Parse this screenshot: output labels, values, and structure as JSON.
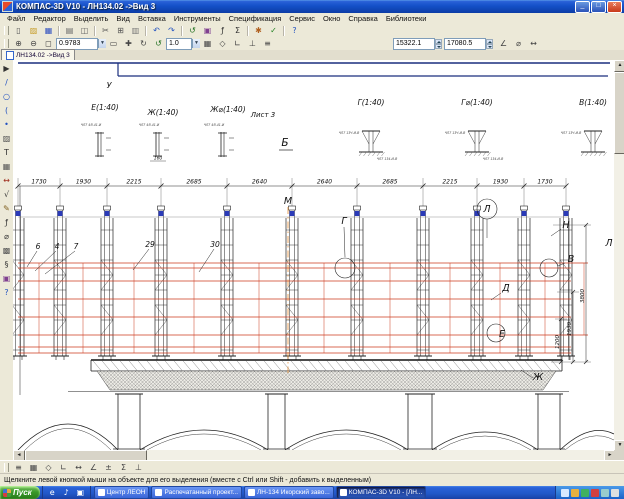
{
  "titlebar": {
    "title": "КОМПАС-3D V10 - ЛН134.02 ->Вид 3"
  },
  "menubar": {
    "items": [
      "Файл",
      "Редактор",
      "Выделить",
      "Вид",
      "Вставка",
      "Инструменты",
      "Спецификация",
      "Сервис",
      "Окно",
      "Справка",
      "Библиотеки"
    ]
  },
  "toolbar_main": {
    "icons": [
      {
        "name": "new-document-icon",
        "glyph": "▯",
        "color": "#555"
      },
      {
        "name": "open-document-icon",
        "glyph": "▨",
        "color": "#c8a030"
      },
      {
        "name": "save-icon",
        "glyph": "▦",
        "color": "#3050c0"
      },
      {
        "sep": true
      },
      {
        "name": "print-icon",
        "glyph": "▤",
        "color": "#666"
      },
      {
        "name": "print-preview-icon",
        "glyph": "◫",
        "color": "#666"
      },
      {
        "sep": true
      },
      {
        "name": "cut-icon",
        "glyph": "✂",
        "color": "#555"
      },
      {
        "name": "copy-icon",
        "glyph": "⊞",
        "color": "#555"
      },
      {
        "name": "paste-icon",
        "glyph": "▥",
        "color": "#777"
      },
      {
        "sep": true
      },
      {
        "name": "undo-icon",
        "glyph": "↶",
        "color": "#2050c0"
      },
      {
        "name": "redo-icon",
        "glyph": "↷",
        "color": "#2050c0"
      },
      {
        "sep": true
      },
      {
        "name": "rebuild-view-icon",
        "glyph": "↺",
        "color": "#207020"
      },
      {
        "name": "library-manager-icon",
        "glyph": "▣",
        "color": "#804090"
      },
      {
        "name": "variables-icon",
        "glyph": "ƒ",
        "color": "#333"
      },
      {
        "name": "calculator-icon",
        "glyph": "Σ",
        "color": "#333"
      },
      {
        "sep": true
      },
      {
        "name": "properties-icon",
        "glyph": "✱",
        "color": "#b06020"
      },
      {
        "name": "spell-check-icon",
        "glyph": "✓",
        "color": "#208020"
      },
      {
        "sep": true
      },
      {
        "name": "help-icon",
        "glyph": "?",
        "color": "#2050c0"
      }
    ]
  },
  "toolbar_view": {
    "icons_left": [
      {
        "name": "zoom-in-icon",
        "glyph": "⊕",
        "color": "#444"
      },
      {
        "name": "zoom-out-icon",
        "glyph": "⊖",
        "color": "#444"
      },
      {
        "name": "zoom-area-icon",
        "glyph": "◻",
        "color": "#444"
      }
    ],
    "zoom_value": "0.9783",
    "icons_mid": [
      {
        "name": "zoom-fit-icon",
        "glyph": "▭",
        "color": "#444"
      },
      {
        "name": "pan-icon",
        "glyph": "✚",
        "color": "#444"
      },
      {
        "name": "rotate-view-icon",
        "glyph": "↻",
        "color": "#444"
      },
      {
        "name": "refresh-icon",
        "glyph": "↺",
        "color": "#207020"
      }
    ],
    "step_value": "1.0",
    "icons_mid2": [
      {
        "name": "grid-icon",
        "glyph": "▦",
        "color": "#444"
      },
      {
        "name": "snap-icon",
        "glyph": "◇",
        "color": "#444"
      },
      {
        "name": "ortho-icon",
        "glyph": "∟",
        "color": "#444"
      },
      {
        "name": "local-csys-icon",
        "glyph": "⊥",
        "color": "#444"
      },
      {
        "name": "layers-icon",
        "glyph": "≡",
        "color": "#444"
      }
    ],
    "coord_x": "15322.1",
    "coord_y": "17080.5",
    "icons_right": [
      {
        "name": "angle-icon",
        "glyph": "∠",
        "color": "#444"
      },
      {
        "name": "diameter-icon",
        "glyph": "⌀",
        "color": "#444"
      },
      {
        "name": "measure-icon",
        "glyph": "↔",
        "color": "#444"
      }
    ]
  },
  "tabbar": {
    "tabs": [
      {
        "label": "ЛН134.02 ->Вид 3"
      }
    ]
  },
  "toolpanel": {
    "icons": [
      {
        "name": "pointer-icon",
        "glyph": "▶",
        "color": "#333"
      },
      {
        "name": "line-icon",
        "glyph": "/",
        "color": "#2050c0"
      },
      {
        "name": "circle-icon",
        "glyph": "○",
        "color": "#2050c0"
      },
      {
        "name": "arc-icon",
        "glyph": "(",
        "color": "#2050c0"
      },
      {
        "name": "point-icon",
        "glyph": "•",
        "color": "#2050c0"
      },
      {
        "name": "hatch-icon",
        "glyph": "▨",
        "color": "#555"
      },
      {
        "name": "text-icon",
        "glyph": "T",
        "color": "#333"
      },
      {
        "name": "table-icon",
        "glyph": "▦",
        "color": "#555"
      },
      {
        "name": "dimension-icon",
        "glyph": "↔",
        "color": "#a03020"
      },
      {
        "name": "designation-icon",
        "glyph": "√",
        "color": "#333"
      },
      {
        "name": "edit-icon",
        "glyph": "✎",
        "color": "#806020"
      },
      {
        "name": "parametric-icon",
        "glyph": "ƒ",
        "color": "#333"
      },
      {
        "name": "measure-tool-icon",
        "glyph": "⌀",
        "color": "#333"
      },
      {
        "name": "select-icon",
        "glyph": "▩",
        "color": "#555"
      },
      {
        "name": "specification-icon",
        "glyph": "§",
        "color": "#333"
      },
      {
        "name": "collections-icon",
        "glyph": "▣",
        "color": "#804090"
      },
      {
        "name": "panel-help-icon",
        "glyph": "?",
        "color": "#2050c0"
      }
    ]
  },
  "drawing": {
    "frame_letter": "У",
    "sheet_note": "Лист 3",
    "sections": [
      {
        "label": "Е(1:40)",
        "note": "ЧЛ7 4Я-41-И"
      },
      {
        "label": "Ж(1:40)",
        "note": "ЧЛ7 4Я-41-И",
        "dim": "160"
      },
      {
        "label": "Ж⌀(1:40)",
        "note": "ЧЛ7 4Я-41-И"
      },
      {
        "label": "Г(1:40)",
        "note": "ЧЛ7 13Ч-И-В",
        "note2": "ЧЛ7 134-И-В"
      },
      {
        "label": "Г⌀(1:40)",
        "note": "ЧЛ7 13Ч-И-В",
        "note2": "ЧЛ7 134-И-В"
      },
      {
        "label": "В(1:40)",
        "note": "ЧЛ7 13Ч-И-В"
      }
    ],
    "dims_top": [
      "1730",
      "1930",
      "2215",
      "2685",
      "2640",
      "2640",
      "2685",
      "2215",
      "1930",
      "1730"
    ],
    "dims_right": [
      "3800",
      "1930",
      "1200"
    ],
    "callouts": [
      "Б",
      "М",
      "Г",
      "Л",
      "Н",
      "В",
      "Д",
      "Е",
      "Ж",
      "Л"
    ],
    "part_refs": [
      "6",
      "4",
      "7",
      "29",
      "30"
    ]
  },
  "panel_bottom": {
    "icons": [
      {
        "name": "layer-icon",
        "glyph": "≡",
        "color": "#444"
      },
      {
        "name": "grid-toggle-icon",
        "glyph": "▦",
        "color": "#444"
      },
      {
        "name": "snap-toggle-icon",
        "glyph": "◇",
        "color": "#444"
      },
      {
        "name": "ortho-toggle-icon",
        "glyph": "∟",
        "color": "#444"
      },
      {
        "name": "step-icon",
        "glyph": "↔",
        "color": "#444"
      },
      {
        "name": "angle-snap-icon",
        "glyph": "∠",
        "color": "#444"
      },
      {
        "name": "round-icon",
        "glyph": "±",
        "color": "#444"
      },
      {
        "name": "calc-icon",
        "glyph": "Σ",
        "color": "#444"
      },
      {
        "name": "coords-mode-icon",
        "glyph": "⊥",
        "color": "#444"
      }
    ]
  },
  "statusbar": {
    "hint": "Щелкните левой кнопкой мыши на объекте для его выделения (вместе с Ctrl или Shift - добавить к выделенным)"
  },
  "taskbar": {
    "start_label": "Пуск",
    "quick_launch": [
      {
        "name": "internet-explorer-icon",
        "glyph": "e",
        "color": "#fff"
      },
      {
        "name": "media-player-icon",
        "glyph": "♪",
        "color": "#fff"
      },
      {
        "name": "show-desktop-icon",
        "glyph": "▣",
        "color": "#fff"
      }
    ],
    "windows": [
      {
        "label": "Центр ЛЕОН",
        "active": false
      },
      {
        "label": "Распечатанный проект...",
        "active": false
      },
      {
        "label": "ЛН-134 Икорский заво...",
        "active": false
      },
      {
        "label": "КОМПАС-3D V10 - [ЛН...",
        "active": true
      }
    ],
    "tray_colors": [
      "#d8e8ff",
      "#e8b040",
      "#40b060",
      "#d04040",
      "#9cc",
      "#e0e0e0"
    ]
  }
}
